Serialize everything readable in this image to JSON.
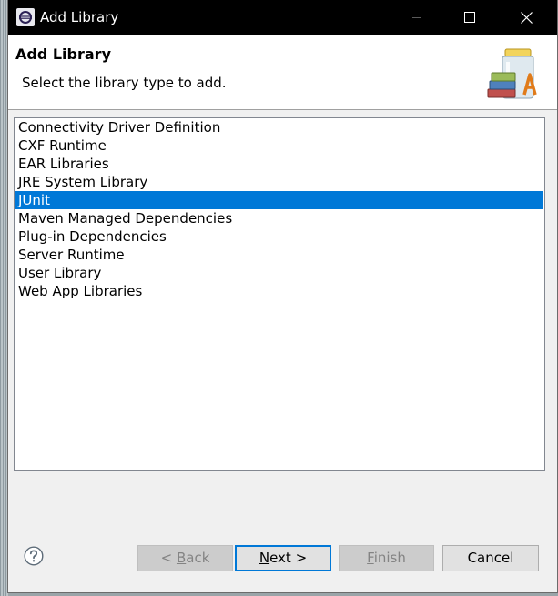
{
  "window": {
    "title": "Add Library"
  },
  "header": {
    "title": "Add Library",
    "description": "Select the library type to add."
  },
  "library_types": [
    {
      "label": "Connectivity Driver Definition",
      "selected": false
    },
    {
      "label": "CXF Runtime",
      "selected": false
    },
    {
      "label": "EAR Libraries",
      "selected": false
    },
    {
      "label": "JRE System Library",
      "selected": false
    },
    {
      "label": "JUnit",
      "selected": true
    },
    {
      "label": "Maven Managed Dependencies",
      "selected": false
    },
    {
      "label": "Plug-in Dependencies",
      "selected": false
    },
    {
      "label": "Server Runtime",
      "selected": false
    },
    {
      "label": "User Library",
      "selected": false
    },
    {
      "label": "Web App Libraries",
      "selected": false
    }
  ],
  "buttons": {
    "back": {
      "pre": "< ",
      "mnemonic": "B",
      "post": "ack",
      "enabled": false
    },
    "next": {
      "pre": "",
      "mnemonic": "N",
      "post": "ext >",
      "enabled": true
    },
    "finish": {
      "pre": "",
      "mnemonic": "F",
      "post": "inish",
      "enabled": false
    },
    "cancel": {
      "label": "Cancel",
      "enabled": true
    }
  },
  "colors": {
    "titlebar": "#000000",
    "selection": "#0078d7",
    "dialog_bg": "#f0f0f0"
  },
  "icons": {
    "app": "eclipse-icon",
    "header": "library-jar-icon",
    "help": "help-icon",
    "minimize": "minimize-icon",
    "maximize": "maximize-icon",
    "close": "close-icon"
  }
}
